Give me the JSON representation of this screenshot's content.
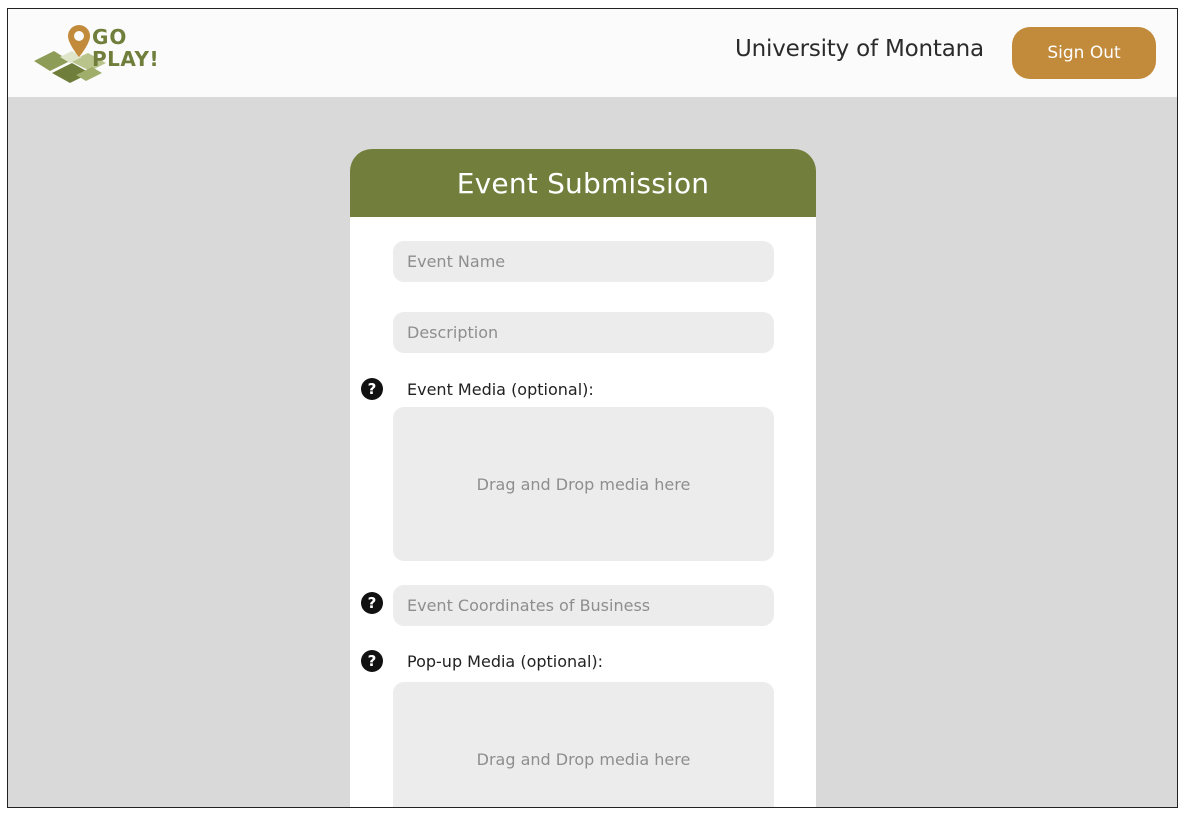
{
  "header": {
    "logo": {
      "line1": "GO",
      "line2": "PLAY!",
      "colors": {
        "green": "#6f7e3b",
        "light_green": "#9fae6a",
        "orange": "#c28a3b"
      }
    },
    "organization": "University of Montana",
    "signout_label": "Sign Out"
  },
  "form": {
    "title": "Event Submission",
    "event_name_placeholder": "Event Name",
    "description_placeholder": "Description",
    "event_media_label": "Event Media (optional):",
    "event_media_drop_text": "Drag and Drop media here",
    "coordinates_placeholder": "Event Coordinates of Business",
    "popup_media_label": "Pop-up Media (optional):",
    "popup_media_drop_text": "Drag and Drop media here",
    "help_icon_glyph": "?"
  },
  "colors": {
    "header_green": "#727e3c",
    "button_orange": "#c28a3b",
    "page_bg": "#d9d9d9",
    "field_bg": "#ececec"
  }
}
